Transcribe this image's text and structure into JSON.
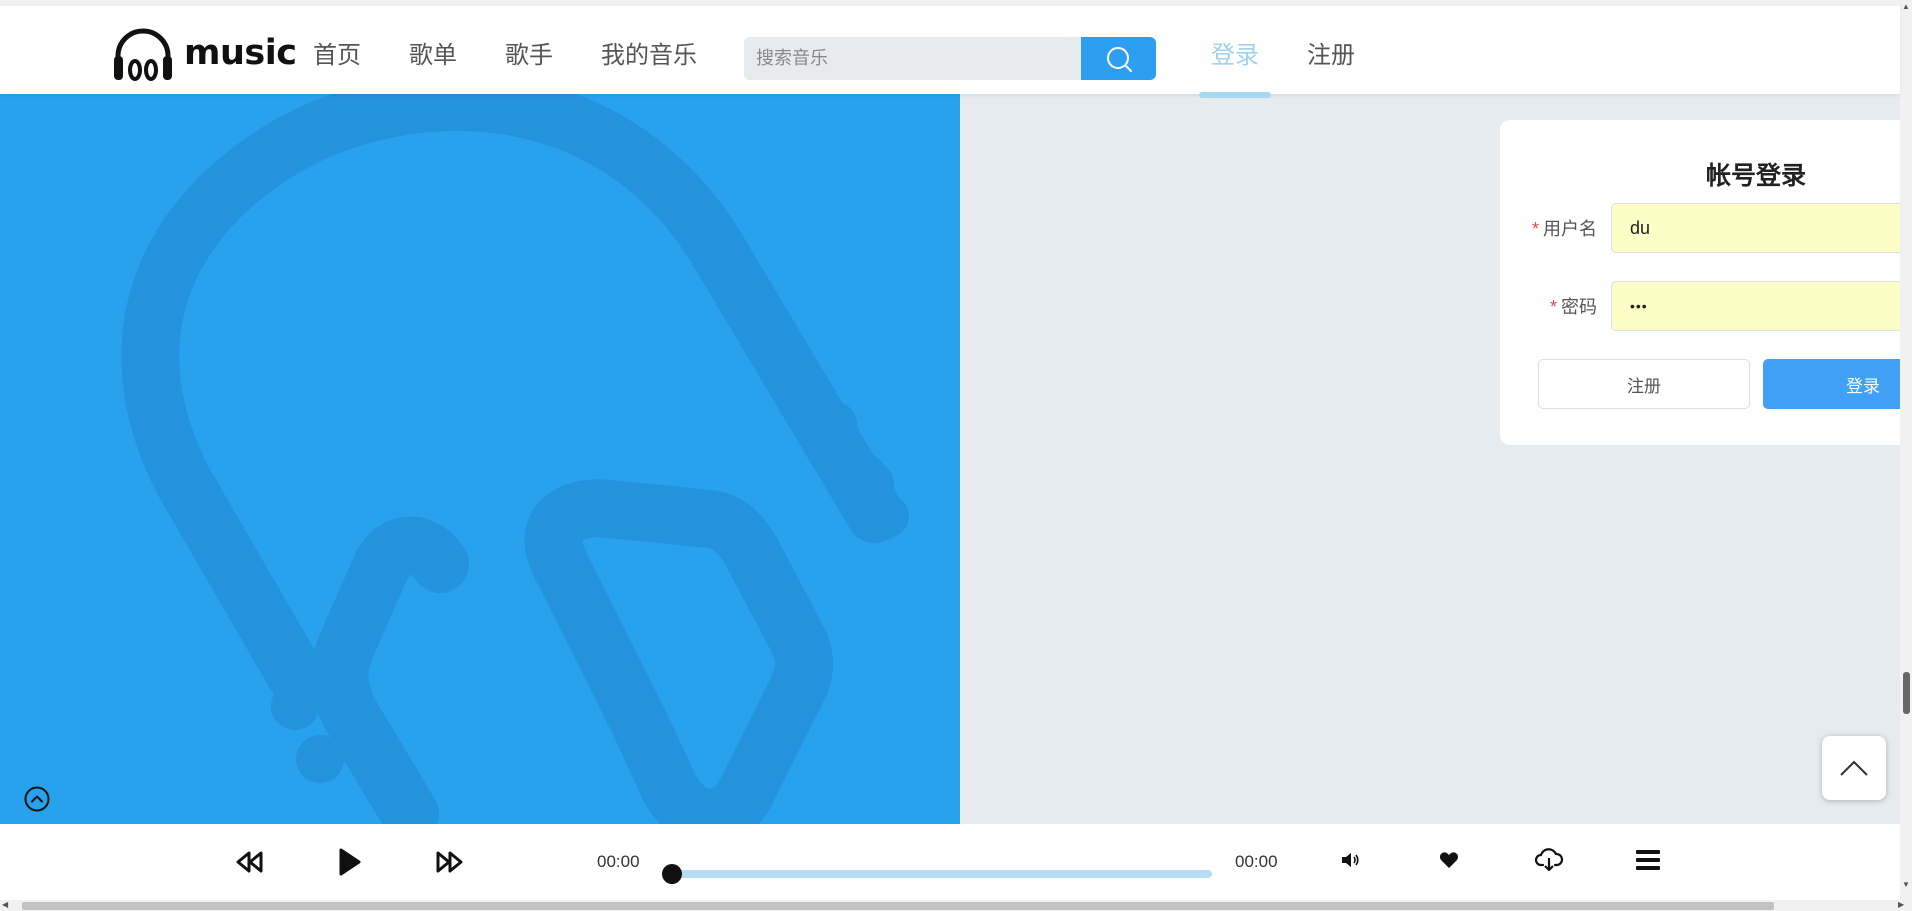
{
  "header": {
    "logo_text": "music",
    "nav": [
      {
        "label": "首页"
      },
      {
        "label": "歌单"
      },
      {
        "label": "歌手"
      },
      {
        "label": "我的音乐"
      }
    ],
    "search": {
      "placeholder": "搜索音乐",
      "value": ""
    },
    "auth": {
      "login": "登录",
      "register": "注册",
      "active": "login"
    }
  },
  "login_form": {
    "title": "帐号登录",
    "username_label": "用户名",
    "username_value": "du",
    "password_label": "密码",
    "password_value": "•••",
    "required_mark": "*",
    "register_button": "注册",
    "login_button": "登录"
  },
  "player": {
    "current_time": "00:00",
    "duration": "00:00",
    "progress": 0
  },
  "colors": {
    "accent": "#2d9ff0",
    "banner": "#29a2ed",
    "active_nav": "#9fd3ec",
    "autofill": "#fdfdc7",
    "page_bg": "#e6ebf0"
  },
  "icons": {
    "logo": "headphones-icon",
    "search": "search-icon",
    "prev": "rewind-icon",
    "play": "play-icon",
    "next": "fast-forward-icon",
    "volume": "volume-icon",
    "like": "heart-icon",
    "download": "cloud-download-icon",
    "playlist": "menu-icon",
    "back_to_top": "chevron-up-icon",
    "collapse": "circle-chevron-up-icon"
  }
}
